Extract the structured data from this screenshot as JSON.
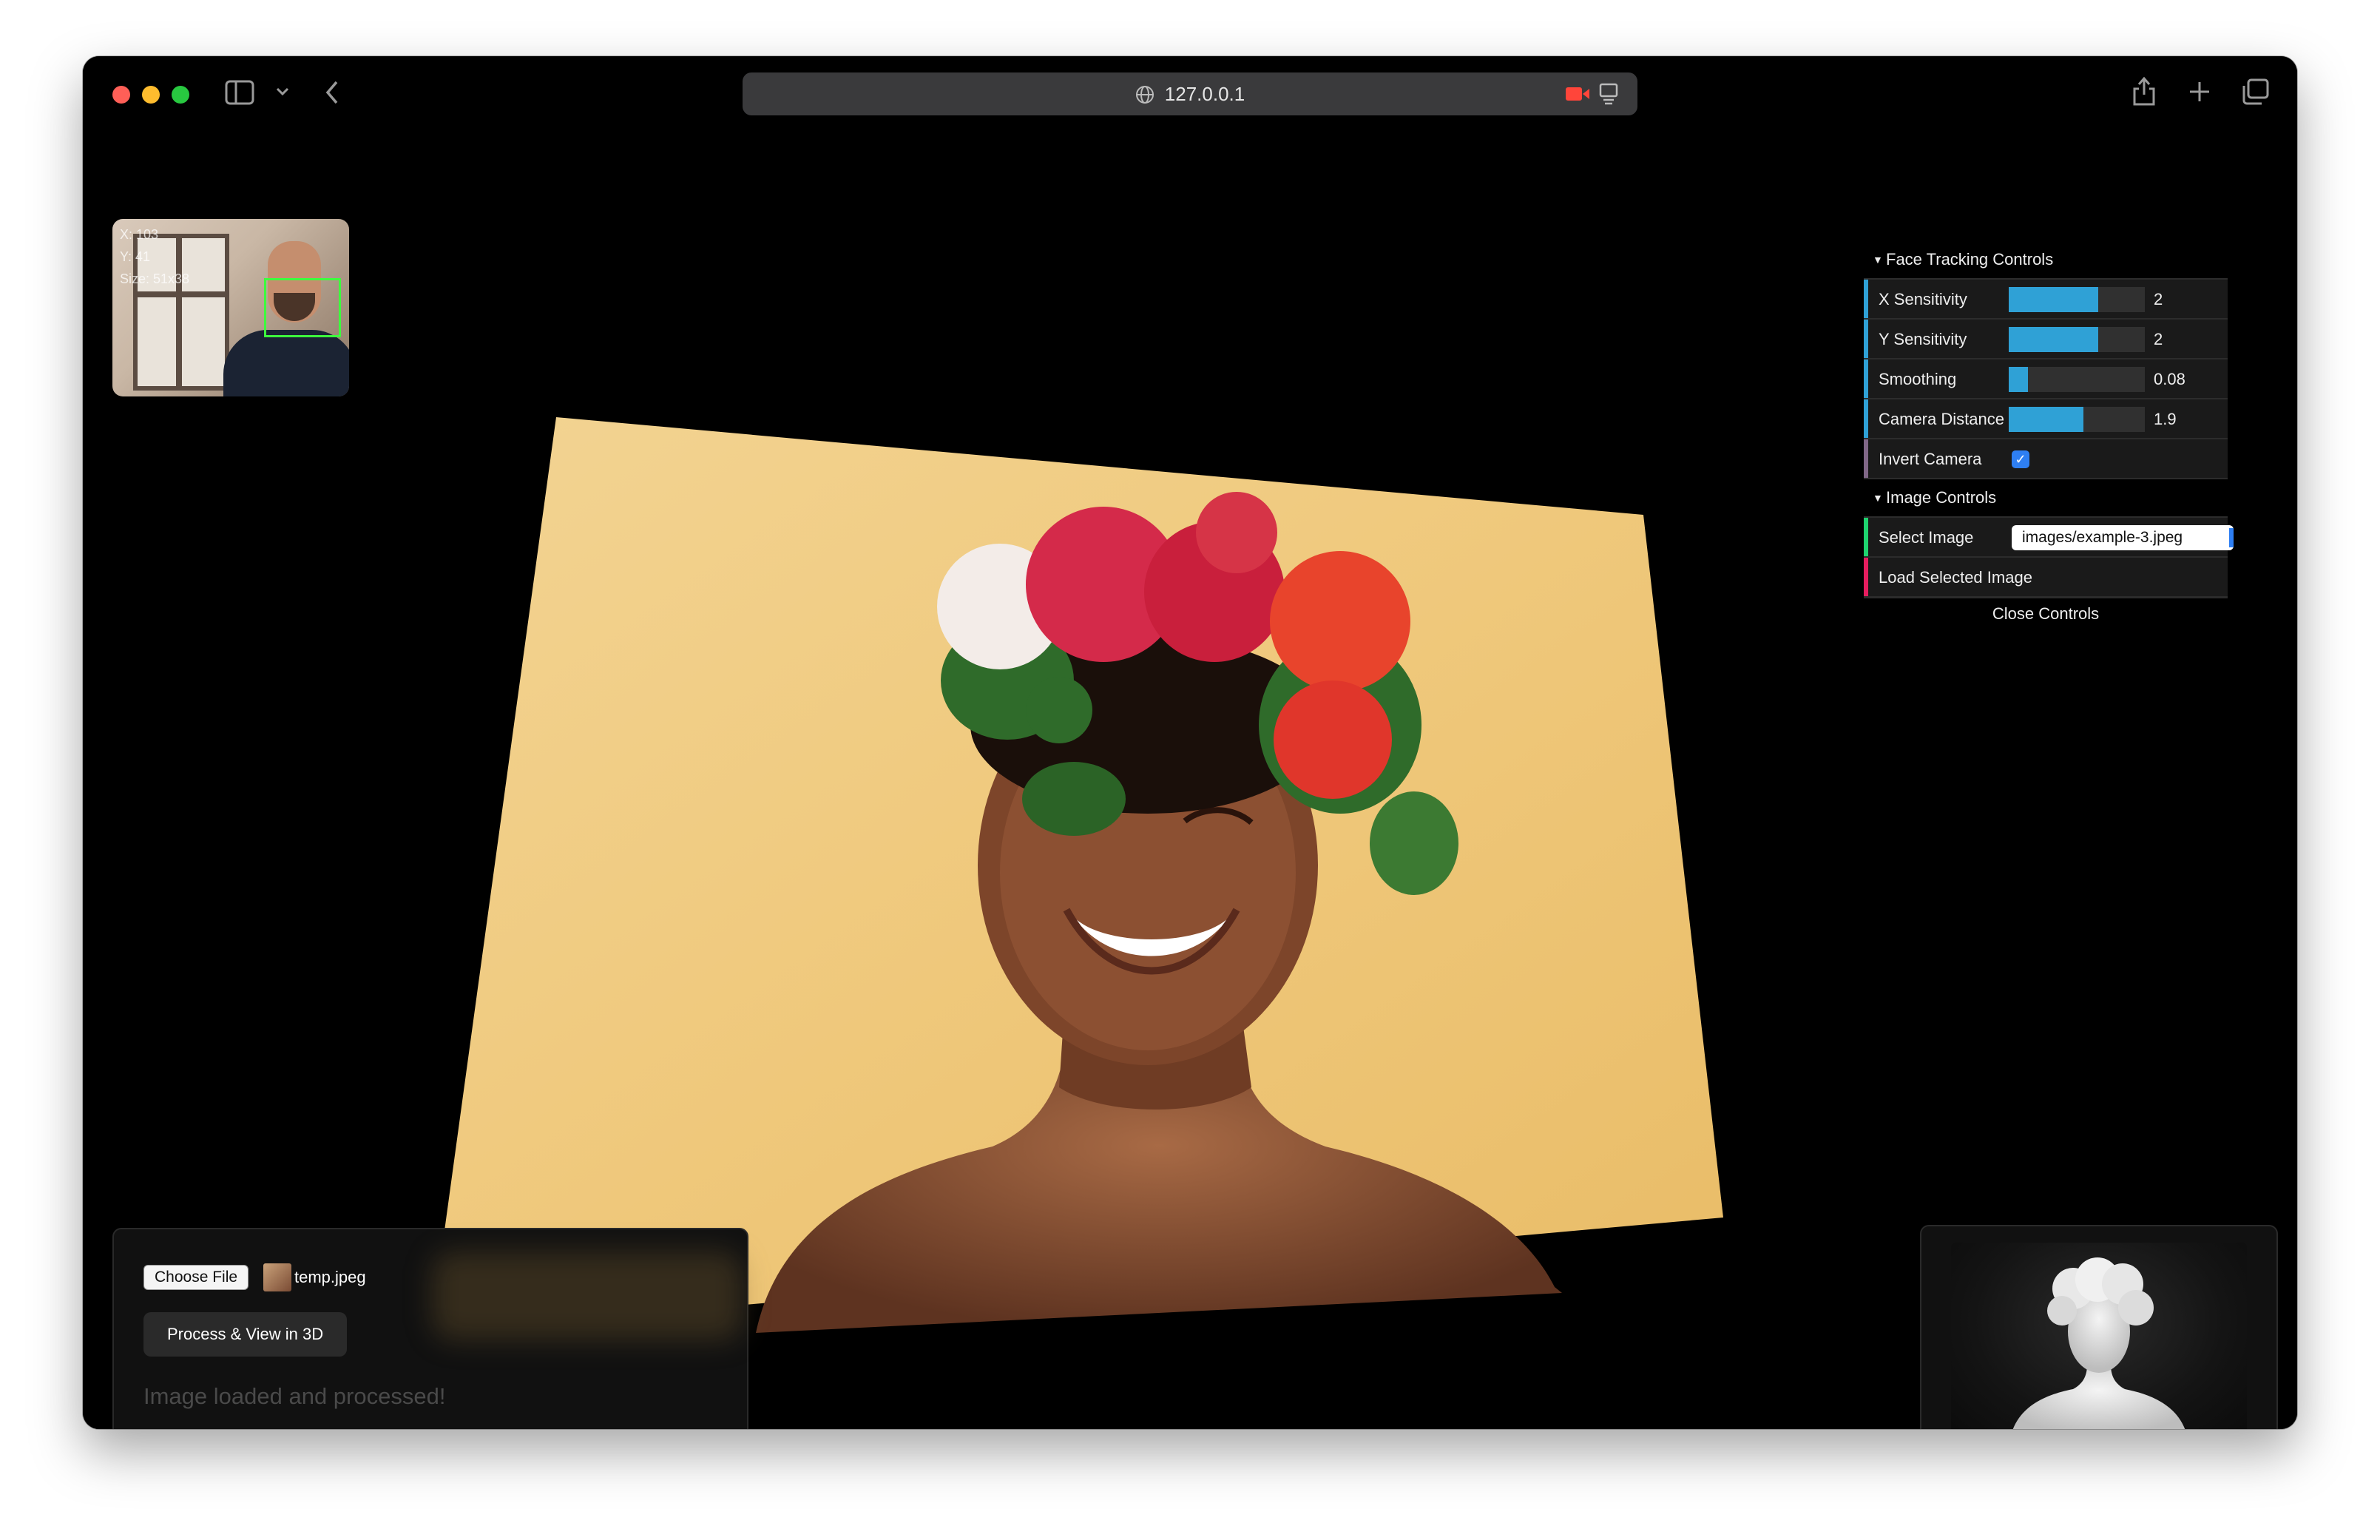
{
  "browser": {
    "url": "127.0.0.1"
  },
  "webcam": {
    "x_text": "X: 103",
    "y_text": "Y: 41",
    "size_text": "Size: 51x38"
  },
  "gui": {
    "face_folder": "Face Tracking Controls",
    "image_folder": "Image Controls",
    "close_label": "Close Controls",
    "controls": [
      {
        "label": "X Sensitivity",
        "value": "2",
        "fill": 0.66
      },
      {
        "label": "Y Sensitivity",
        "value": "2",
        "fill": 0.66
      },
      {
        "label": "Smoothing",
        "value": "0.08",
        "fill": 0.14
      },
      {
        "label": "Camera Distance",
        "value": "1.9",
        "fill": 0.55
      }
    ],
    "invert_label": "Invert Camera",
    "invert_checked": true,
    "select_label": "Select Image",
    "select_value": "images/example-3.jpeg",
    "load_label": "Load Selected Image"
  },
  "upload": {
    "choose_label": "Choose File",
    "filename": "temp.jpeg",
    "process_label": "Process & View in 3D",
    "status": "Image loaded and processed!"
  },
  "colors": {
    "accent_blue": "#2fa1d6",
    "stripe_number": "#2fa1d6",
    "stripe_boolean": "#806787",
    "stripe_string": "#1ed36f",
    "stripe_function": "#e61d5f",
    "backdrop_yellow": "#f0c97a"
  }
}
